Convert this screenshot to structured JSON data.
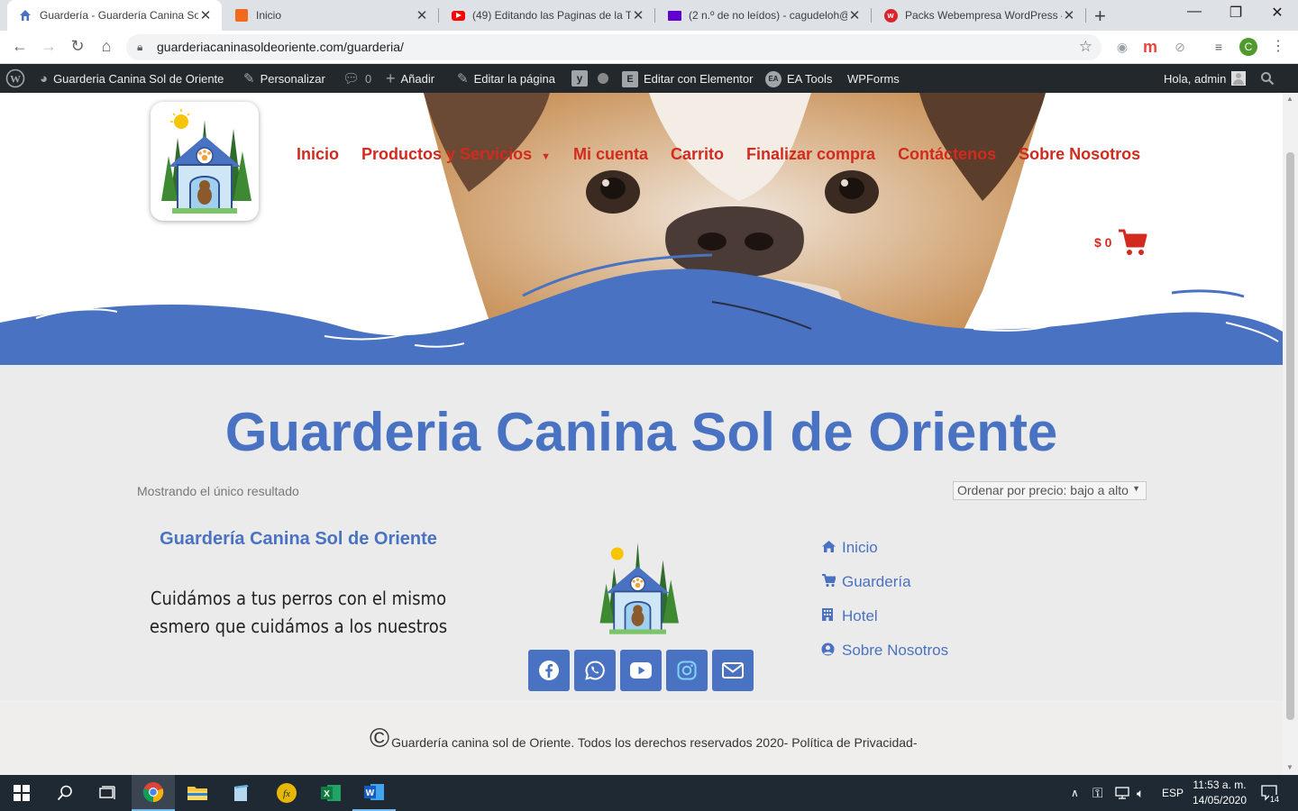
{
  "browser": {
    "tabs": [
      {
        "title": "Guardería - Guardería Canina Sol",
        "icon": "house-icon",
        "active": true
      },
      {
        "title": "Inicio",
        "icon": "orange-site-icon",
        "active": false
      },
      {
        "title": "(49) Editando las Paginas de la Ti",
        "icon": "youtube-icon",
        "active": false
      },
      {
        "title": "(2 n.º de no leídos) - cagudeloh@",
        "icon": "yahoo-mail-icon",
        "active": false
      },
      {
        "title": "Packs Webempresa WordPress –",
        "icon": "webempresa-icon",
        "active": false
      }
    ],
    "url": "guarderiacaninasoldeoriente.com/guarderia/",
    "profile_initial": "C"
  },
  "admin_bar": {
    "site_name": "Guarderia Canina Sol de Oriente",
    "customize": "Personalizar",
    "comments_count": "0",
    "add_new": "Añadir",
    "edit_page": "Editar la página",
    "elementor": "Editar con Elementor",
    "ea_tools": "EA Tools",
    "wpforms": "WPForms",
    "greeting": "Hola, admin"
  },
  "header": {
    "nav": [
      "Inicio",
      "Productos y Servicios",
      "Mi cuenta",
      "Carrito",
      "Finalizar compra",
      "Contáctenos",
      "Sobre Nosotros"
    ],
    "cart_total": "$ 0"
  },
  "main": {
    "title": "Guarderia Canina Sol de Oriente",
    "result_count": "Mostrando el único resultado",
    "orderby_selected": "Ordenar por precio: bajo a alto"
  },
  "footer_widgets": {
    "title": "Guardería Canina Sol de Oriente",
    "tagline_line1": "Cuidámos a tus perros con el mismo",
    "tagline_line2": "esmero que cuidámos a los nuestros",
    "social": [
      "facebook-icon",
      "whatsapp-icon",
      "youtube-icon",
      "instagram-icon",
      "email-icon"
    ],
    "links": [
      {
        "label": "Inicio",
        "icon": "home-icon"
      },
      {
        "label": "Guardería",
        "icon": "cart-icon"
      },
      {
        "label": "Hotel",
        "icon": "building-icon"
      },
      {
        "label": "Sobre Nosotros",
        "icon": "user-circle-icon"
      }
    ]
  },
  "footer": {
    "copyright_symbol": "©",
    "copyright": "Guardería canina sol de Oriente. Todos los derechos reservados 2020- Política de Privacidad-"
  },
  "taskbar": {
    "lang": "ESP",
    "time": "11:53 a. m.",
    "date": "14/05/2020",
    "notifications": "14"
  },
  "colors": {
    "brand_blue": "#4a72c2",
    "nav_red": "#d32a1f",
    "admin_bar": "#23282d"
  }
}
